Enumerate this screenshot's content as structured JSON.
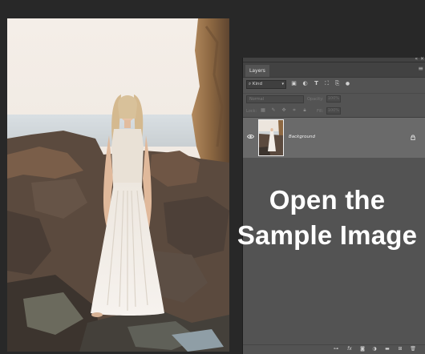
{
  "layers_panel": {
    "tab_label": "Layers",
    "menu_icon": "hamburger-menu-icon",
    "filter": {
      "kind_label": "Kind",
      "icons": [
        "image-filter-icon",
        "adjustment-filter-icon",
        "type-filter-icon",
        "shape-filter-icon",
        "smart-object-filter-icon",
        "filter-toggle-icon"
      ]
    },
    "blend_mode": "Normal",
    "opacity_label": "Opacity:",
    "opacity_value": "100%",
    "lock_label": "Lock:",
    "fill_label": "Fill:",
    "fill_value": "100%",
    "layers": [
      {
        "name": "Background",
        "visible": true,
        "locked": true
      }
    ],
    "bottom_icons": [
      "link-layers-icon",
      "fx-icon",
      "mask-icon",
      "adjustment-icon",
      "group-icon",
      "new-layer-icon",
      "delete-icon"
    ]
  },
  "overlay": {
    "line1": "Open the",
    "line2": "Sample Image"
  },
  "colors": {
    "app_background": "#282828",
    "panel_background": "#535353",
    "selected_layer": "#6a6a6a",
    "overlay_text": "#ffffff"
  }
}
